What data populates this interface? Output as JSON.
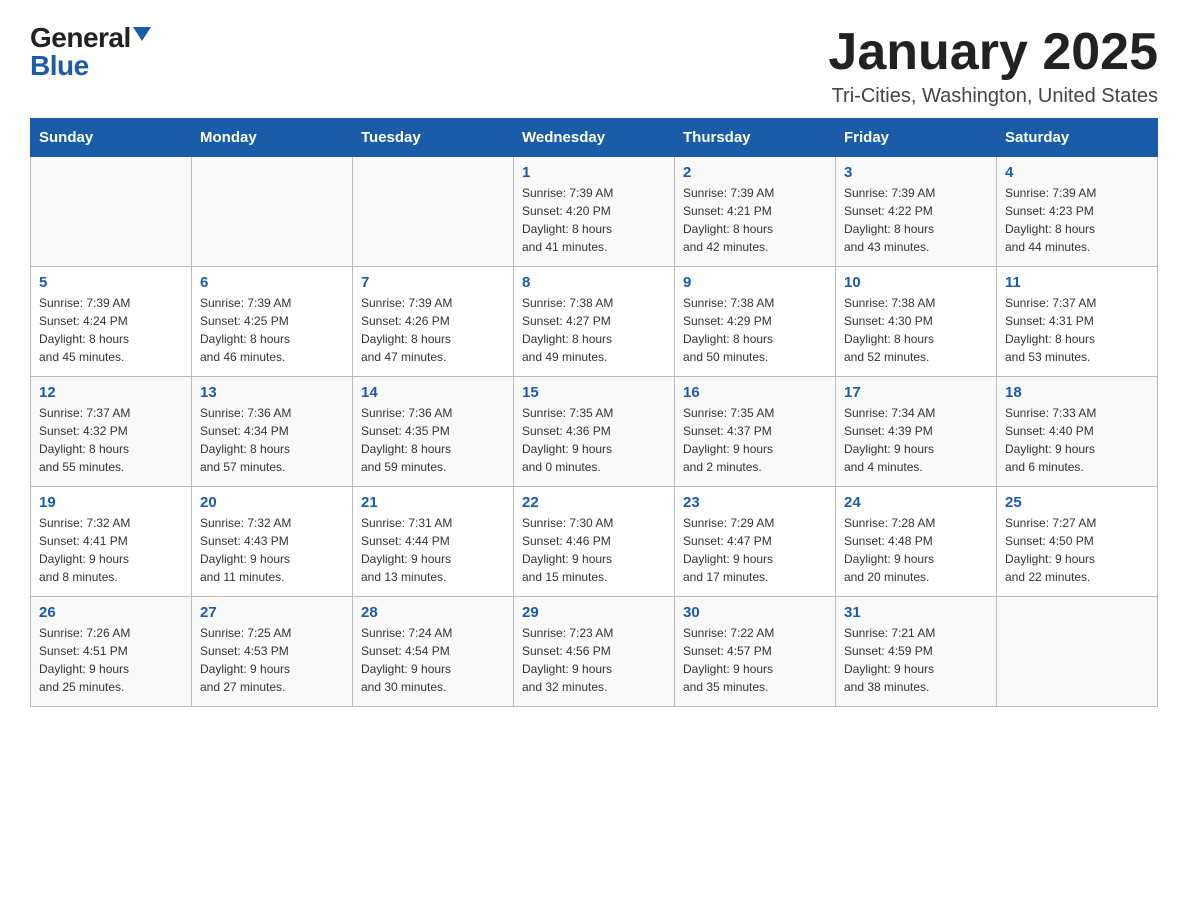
{
  "header": {
    "logo_general": "General",
    "logo_blue": "Blue",
    "title": "January 2025",
    "location": "Tri-Cities, Washington, United States"
  },
  "days_of_week": [
    "Sunday",
    "Monday",
    "Tuesday",
    "Wednesday",
    "Thursday",
    "Friday",
    "Saturday"
  ],
  "weeks": [
    [
      {
        "day": "",
        "info": ""
      },
      {
        "day": "",
        "info": ""
      },
      {
        "day": "",
        "info": ""
      },
      {
        "day": "1",
        "info": "Sunrise: 7:39 AM\nSunset: 4:20 PM\nDaylight: 8 hours\nand 41 minutes."
      },
      {
        "day": "2",
        "info": "Sunrise: 7:39 AM\nSunset: 4:21 PM\nDaylight: 8 hours\nand 42 minutes."
      },
      {
        "day": "3",
        "info": "Sunrise: 7:39 AM\nSunset: 4:22 PM\nDaylight: 8 hours\nand 43 minutes."
      },
      {
        "day": "4",
        "info": "Sunrise: 7:39 AM\nSunset: 4:23 PM\nDaylight: 8 hours\nand 44 minutes."
      }
    ],
    [
      {
        "day": "5",
        "info": "Sunrise: 7:39 AM\nSunset: 4:24 PM\nDaylight: 8 hours\nand 45 minutes."
      },
      {
        "day": "6",
        "info": "Sunrise: 7:39 AM\nSunset: 4:25 PM\nDaylight: 8 hours\nand 46 minutes."
      },
      {
        "day": "7",
        "info": "Sunrise: 7:39 AM\nSunset: 4:26 PM\nDaylight: 8 hours\nand 47 minutes."
      },
      {
        "day": "8",
        "info": "Sunrise: 7:38 AM\nSunset: 4:27 PM\nDaylight: 8 hours\nand 49 minutes."
      },
      {
        "day": "9",
        "info": "Sunrise: 7:38 AM\nSunset: 4:29 PM\nDaylight: 8 hours\nand 50 minutes."
      },
      {
        "day": "10",
        "info": "Sunrise: 7:38 AM\nSunset: 4:30 PM\nDaylight: 8 hours\nand 52 minutes."
      },
      {
        "day": "11",
        "info": "Sunrise: 7:37 AM\nSunset: 4:31 PM\nDaylight: 8 hours\nand 53 minutes."
      }
    ],
    [
      {
        "day": "12",
        "info": "Sunrise: 7:37 AM\nSunset: 4:32 PM\nDaylight: 8 hours\nand 55 minutes."
      },
      {
        "day": "13",
        "info": "Sunrise: 7:36 AM\nSunset: 4:34 PM\nDaylight: 8 hours\nand 57 minutes."
      },
      {
        "day": "14",
        "info": "Sunrise: 7:36 AM\nSunset: 4:35 PM\nDaylight: 8 hours\nand 59 minutes."
      },
      {
        "day": "15",
        "info": "Sunrise: 7:35 AM\nSunset: 4:36 PM\nDaylight: 9 hours\nand 0 minutes."
      },
      {
        "day": "16",
        "info": "Sunrise: 7:35 AM\nSunset: 4:37 PM\nDaylight: 9 hours\nand 2 minutes."
      },
      {
        "day": "17",
        "info": "Sunrise: 7:34 AM\nSunset: 4:39 PM\nDaylight: 9 hours\nand 4 minutes."
      },
      {
        "day": "18",
        "info": "Sunrise: 7:33 AM\nSunset: 4:40 PM\nDaylight: 9 hours\nand 6 minutes."
      }
    ],
    [
      {
        "day": "19",
        "info": "Sunrise: 7:32 AM\nSunset: 4:41 PM\nDaylight: 9 hours\nand 8 minutes."
      },
      {
        "day": "20",
        "info": "Sunrise: 7:32 AM\nSunset: 4:43 PM\nDaylight: 9 hours\nand 11 minutes."
      },
      {
        "day": "21",
        "info": "Sunrise: 7:31 AM\nSunset: 4:44 PM\nDaylight: 9 hours\nand 13 minutes."
      },
      {
        "day": "22",
        "info": "Sunrise: 7:30 AM\nSunset: 4:46 PM\nDaylight: 9 hours\nand 15 minutes."
      },
      {
        "day": "23",
        "info": "Sunrise: 7:29 AM\nSunset: 4:47 PM\nDaylight: 9 hours\nand 17 minutes."
      },
      {
        "day": "24",
        "info": "Sunrise: 7:28 AM\nSunset: 4:48 PM\nDaylight: 9 hours\nand 20 minutes."
      },
      {
        "day": "25",
        "info": "Sunrise: 7:27 AM\nSunset: 4:50 PM\nDaylight: 9 hours\nand 22 minutes."
      }
    ],
    [
      {
        "day": "26",
        "info": "Sunrise: 7:26 AM\nSunset: 4:51 PM\nDaylight: 9 hours\nand 25 minutes."
      },
      {
        "day": "27",
        "info": "Sunrise: 7:25 AM\nSunset: 4:53 PM\nDaylight: 9 hours\nand 27 minutes."
      },
      {
        "day": "28",
        "info": "Sunrise: 7:24 AM\nSunset: 4:54 PM\nDaylight: 9 hours\nand 30 minutes."
      },
      {
        "day": "29",
        "info": "Sunrise: 7:23 AM\nSunset: 4:56 PM\nDaylight: 9 hours\nand 32 minutes."
      },
      {
        "day": "30",
        "info": "Sunrise: 7:22 AM\nSunset: 4:57 PM\nDaylight: 9 hours\nand 35 minutes."
      },
      {
        "day": "31",
        "info": "Sunrise: 7:21 AM\nSunset: 4:59 PM\nDaylight: 9 hours\nand 38 minutes."
      },
      {
        "day": "",
        "info": ""
      }
    ]
  ]
}
